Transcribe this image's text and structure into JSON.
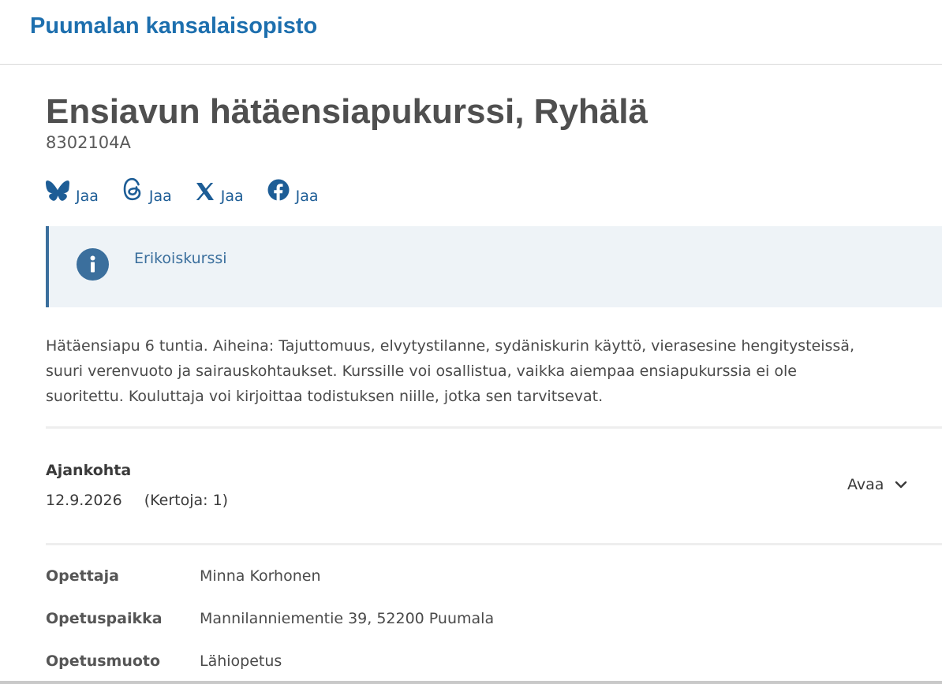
{
  "header": {
    "brand": "Puumalan kansalaisopisto"
  },
  "course": {
    "title": "Ensiavun hätäensiapukurssi, Ryhälä",
    "code": "8302104A"
  },
  "share": [
    {
      "icon": "bluesky-icon",
      "label": "Jaa"
    },
    {
      "icon": "threads-icon",
      "label": "Jaa"
    },
    {
      "icon": "x-icon",
      "label": "Jaa"
    },
    {
      "icon": "facebook-icon",
      "label": "Jaa"
    }
  ],
  "notice": {
    "icon": "info-icon",
    "text": "Erikoiskurssi"
  },
  "description": [
    "Hätäensiapu 6 tuntia. Aiheina: Tajuttomuus, elvytystilanne, sydäniskurin käyttö, vierasesine hengitysteissä,",
    "suuri verenvuoto ja sairauskohtaukset. Kurssille voi osallistua, vaikka aiempaa ensiapukurssia ei ole",
    "suoritettu. Kouluttaja voi kirjoittaa todistuksen niille, jotka sen tarvitsevat."
  ],
  "schedule": {
    "label": "Ajankohta",
    "date": "12.9.2026",
    "count": "(Kertoja: 1)",
    "toggle_label": "Avaa",
    "toggle_icon": "chevron-down-icon"
  },
  "details": [
    {
      "key": "Opettaja",
      "value": "Minna Korhonen"
    },
    {
      "key": "Opetuspaikka",
      "value": "Mannilanniementie 39, 52200 Puumala"
    },
    {
      "key": "Opetusmuoto",
      "value": "Lähiopetus"
    }
  ],
  "colors": {
    "brand": "#1d6fae",
    "share_icons": "#1d5d96",
    "notice_bg": "#eef3f7",
    "notice_accent": "#3b6f9d"
  }
}
